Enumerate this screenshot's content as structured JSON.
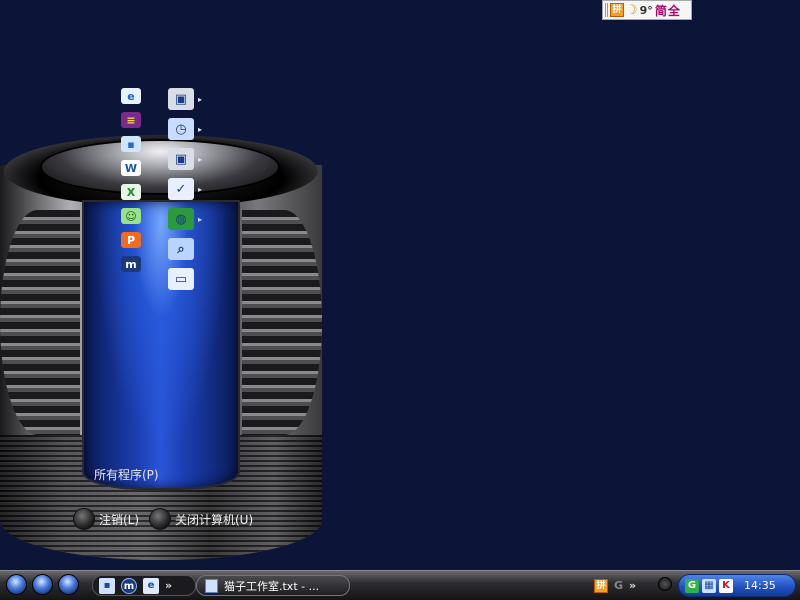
{
  "ime_bar": {
    "logo": "拼",
    "punct": "9°",
    "text": "简全"
  },
  "start_menu": {
    "left_icons": [
      {
        "name": "ie-icon",
        "glyph": "e"
      },
      {
        "name": "winrar-icon",
        "glyph": "≡"
      },
      {
        "name": "notepad-icon",
        "glyph": "▪"
      },
      {
        "name": "word-icon",
        "glyph": "W"
      },
      {
        "name": "excel-icon",
        "glyph": "X"
      },
      {
        "name": "messenger-icon",
        "glyph": "☺"
      },
      {
        "name": "powerpoint-icon",
        "glyph": "P"
      },
      {
        "name": "maxthon-icon",
        "glyph": "m"
      }
    ],
    "right_icons": [
      {
        "name": "camera-icon",
        "glyph": "▣",
        "submenu": true
      },
      {
        "name": "clock-icon",
        "glyph": "◷",
        "submenu": true
      },
      {
        "name": "camera-icon-2",
        "glyph": "▣",
        "submenu": true
      },
      {
        "name": "checklist-icon",
        "glyph": "✓",
        "submenu": true
      },
      {
        "name": "globe-icon",
        "glyph": "◍",
        "submenu": true
      },
      {
        "name": "search-icon",
        "glyph": "⌕",
        "submenu": false
      },
      {
        "name": "run-icon",
        "glyph": "▭",
        "submenu": false
      }
    ],
    "submenu_arrow": "▸",
    "all_programs": "所有程序(P)",
    "logoff": "注销(L)",
    "shutdown": "关闭计算机(U)"
  },
  "taskbar": {
    "quick_launch_chevron": "»",
    "task_title": "猫子工作室.txt - ...",
    "ime_logo": "拼",
    "ime_g": "G",
    "ime_chevron": "»",
    "tray_icons": [
      "G",
      "▦",
      "K"
    ],
    "clock": "14:35"
  },
  "colors": {
    "desktop": "#0c1537",
    "tray_blue": "#1f4fbf"
  }
}
